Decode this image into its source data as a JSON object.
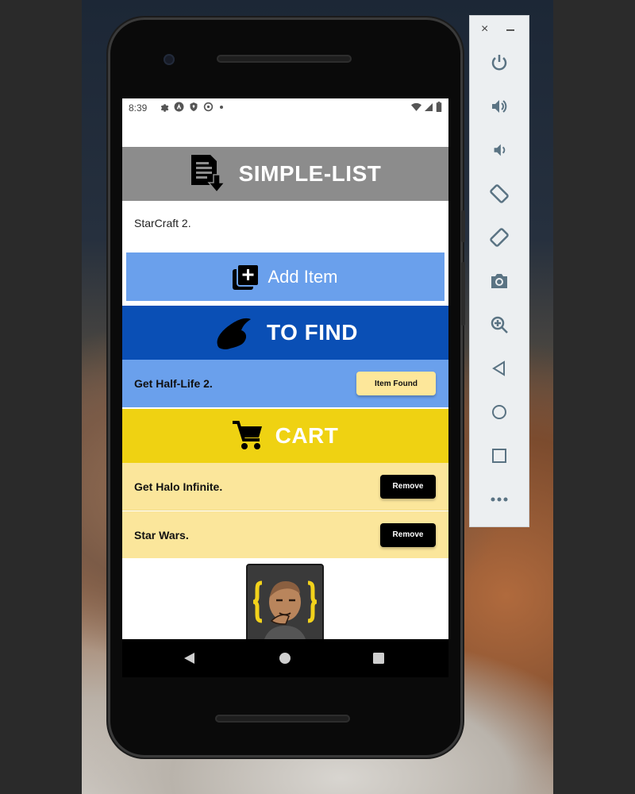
{
  "statusbar": {
    "time": "8:39"
  },
  "app": {
    "title": "SIMPLE-LIST",
    "input_value": "StarCraft 2.",
    "add_label": "Add Item",
    "to_find": {
      "title": "TO FIND",
      "items": [
        {
          "label": "Get Half-Life 2.",
          "action": "Item Found"
        }
      ]
    },
    "cart": {
      "title": "CART",
      "items": [
        {
          "label": "Get Halo Infinite.",
          "action": "Remove"
        },
        {
          "label": "Star Wars.",
          "action": "Remove"
        }
      ]
    }
  },
  "colors": {
    "header_gray": "#8c8c8c",
    "add_blue": "#6aa0ec",
    "find_blue": "#0a4fb5",
    "find_row": "#6aa0ec",
    "cart_yellow": "#efd212",
    "cart_row": "#fbe69b",
    "found_btn": "#fde79a"
  },
  "icons": {
    "header": "document-download-icon",
    "add": "add-box-icon",
    "find": "wizard-hat-icon",
    "cart": "shopping-cart-icon"
  },
  "emulator_toolbar": [
    "close",
    "minimize",
    "power",
    "volume-up",
    "volume-down",
    "rotate-left",
    "rotate-right",
    "screenshot",
    "zoom",
    "back",
    "home",
    "overview",
    "more"
  ]
}
